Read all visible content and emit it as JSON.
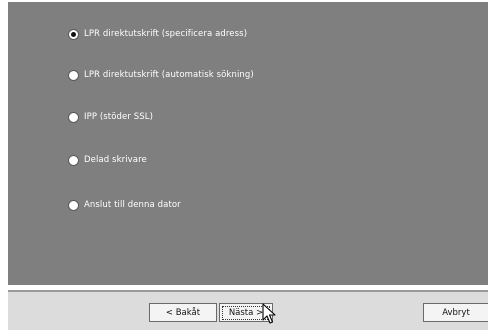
{
  "options": [
    {
      "label": "LPR direktutskrift (specificera adress)",
      "checked": true
    },
    {
      "label": "LPR direktutskrift (automatisk sökning)",
      "checked": false
    },
    {
      "label": "IPP (stöder SSL)",
      "checked": false
    },
    {
      "label": "Delad skrivare",
      "checked": false
    },
    {
      "label": "Anslut till denna dator",
      "checked": false
    }
  ],
  "buttons": {
    "back_label": "< Bakåt",
    "next_label": "Nästa >",
    "cancel_label": "Avbryt"
  },
  "colors": {
    "panel": "#7f7f7f",
    "footer": "#dcdcdc"
  }
}
